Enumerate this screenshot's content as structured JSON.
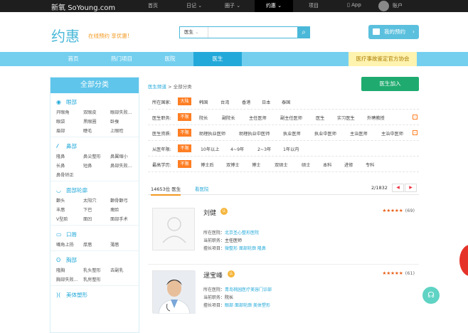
{
  "topbar": {
    "logo_cn": "新氧",
    "logo_en": "SoYoung.com",
    "links": [
      "首页",
      "日记",
      "圈子",
      "约惠",
      "项目"
    ],
    "app": "App",
    "account": "账户"
  },
  "header": {
    "brand": "约惠",
    "slogan": "在线预约 享优惠!",
    "search_select": "医生",
    "search_placeholder": "",
    "my_appointments": "我的预约"
  },
  "nav": {
    "items": [
      "首页",
      "热门项目",
      "医院",
      "医生"
    ],
    "active": "医生",
    "association": "医疗事故鉴定官方协会"
  },
  "sidebar": {
    "title": "全部分类",
    "categories": [
      {
        "icon": "eye-icon",
        "name": "眼部",
        "links": [
          "开眼角",
          "双眼皮",
          "眼部失败...",
          "眼袋",
          "黑眼圈",
          "卧蚕",
          "眉部",
          "睫毛",
          "上眼睑"
        ]
      },
      {
        "icon": "nose-icon",
        "name": "鼻部",
        "links": [
          "隆鼻",
          "鼻尖整形",
          "鼻翼缩小",
          "长鼻",
          "短鼻",
          "鼻部失败...",
          "鼻骨矫正"
        ]
      },
      {
        "icon": "face-contour-icon",
        "name": "面部轮廓",
        "links": [
          "颧头",
          "太阳穴",
          "颧骨颧弓",
          "丰唇",
          "下巴",
          "瘦脸",
          "V型脸",
          "面凹",
          "面部手术"
        ]
      },
      {
        "icon": "mouth-icon",
        "name": "口唇",
        "links": [
          "嘴角上扬",
          "厚唇",
          "薄唇"
        ]
      },
      {
        "icon": "chest-icon",
        "name": "胸部",
        "links": [
          "隆胸",
          "乳头整形",
          "去副乳",
          "胸部失败...",
          "乳房整形"
        ]
      },
      {
        "icon": "body-icon",
        "name": "美体塑形",
        "links": []
      }
    ]
  },
  "main": {
    "breadcrumb": [
      "医生频道",
      "全部分类"
    ],
    "breadcrumb_sep": ">",
    "join_button": "医生加入",
    "filters": [
      {
        "label": "所在国家:",
        "options": [
          "不限",
          "韩国",
          "台湾",
          "香港",
          "日本",
          "泰国"
        ],
        "selected": "大陆"
      },
      {
        "label": "医生职务:",
        "options": [
          "院长",
          "副院长",
          "主任医师",
          "副主任医师",
          "医生",
          "实习医生",
          "外聘教授"
        ],
        "selected": "不限"
      },
      {
        "label": "医生资质:",
        "options": [
          "助理执业医师",
          "助理执业中医师",
          "执业医师",
          "执业中医师",
          "主治医师",
          "主治中医师"
        ],
        "selected": "不限"
      },
      {
        "label": "从医年限:",
        "options": [
          "10年以上",
          "4~9年",
          "2~3年",
          "1年以内"
        ],
        "selected": "不限"
      },
      {
        "label": "最高学历:",
        "options": [
          "博士后",
          "双博士",
          "博士",
          "双硕士",
          "硕士",
          "本科",
          "进修",
          "专科"
        ],
        "selected": "不限"
      }
    ],
    "tabs": {
      "count_label": "14653位 医生",
      "tab2": "看医院",
      "page": "2/1832",
      "prev": "◀",
      "next": "▶"
    },
    "doctors": [
      {
        "name": "刘健",
        "badge": "认",
        "stars": "★★★★★",
        "count": "(69)",
        "hospital_label": "所在医院：",
        "hospital": "北京圣心整形医院",
        "title_label": "当前职务：",
        "title": "主任医师",
        "skill_label": "擅长项目：",
        "skills": [
          "微整形",
          "面部轮廓",
          "隆鼻"
        ]
      },
      {
        "name": "逯宝峰",
        "badge": "认",
        "stars": "★★★★★",
        "count": "(61)",
        "hospital_label": "所在医院：",
        "hospital": "青岛桃园医疗美容门诊部",
        "title_label": "当前职务：",
        "title": "院长",
        "skill_label": "擅长项目：",
        "skills": [
          "眼部",
          "面部轮廓",
          "美体塑形"
        ]
      }
    ]
  },
  "colors": {
    "accent": "#4ab8d8",
    "orange": "#ff7e24",
    "green": "#1fab6f",
    "topbar": "#1e1e1e"
  }
}
